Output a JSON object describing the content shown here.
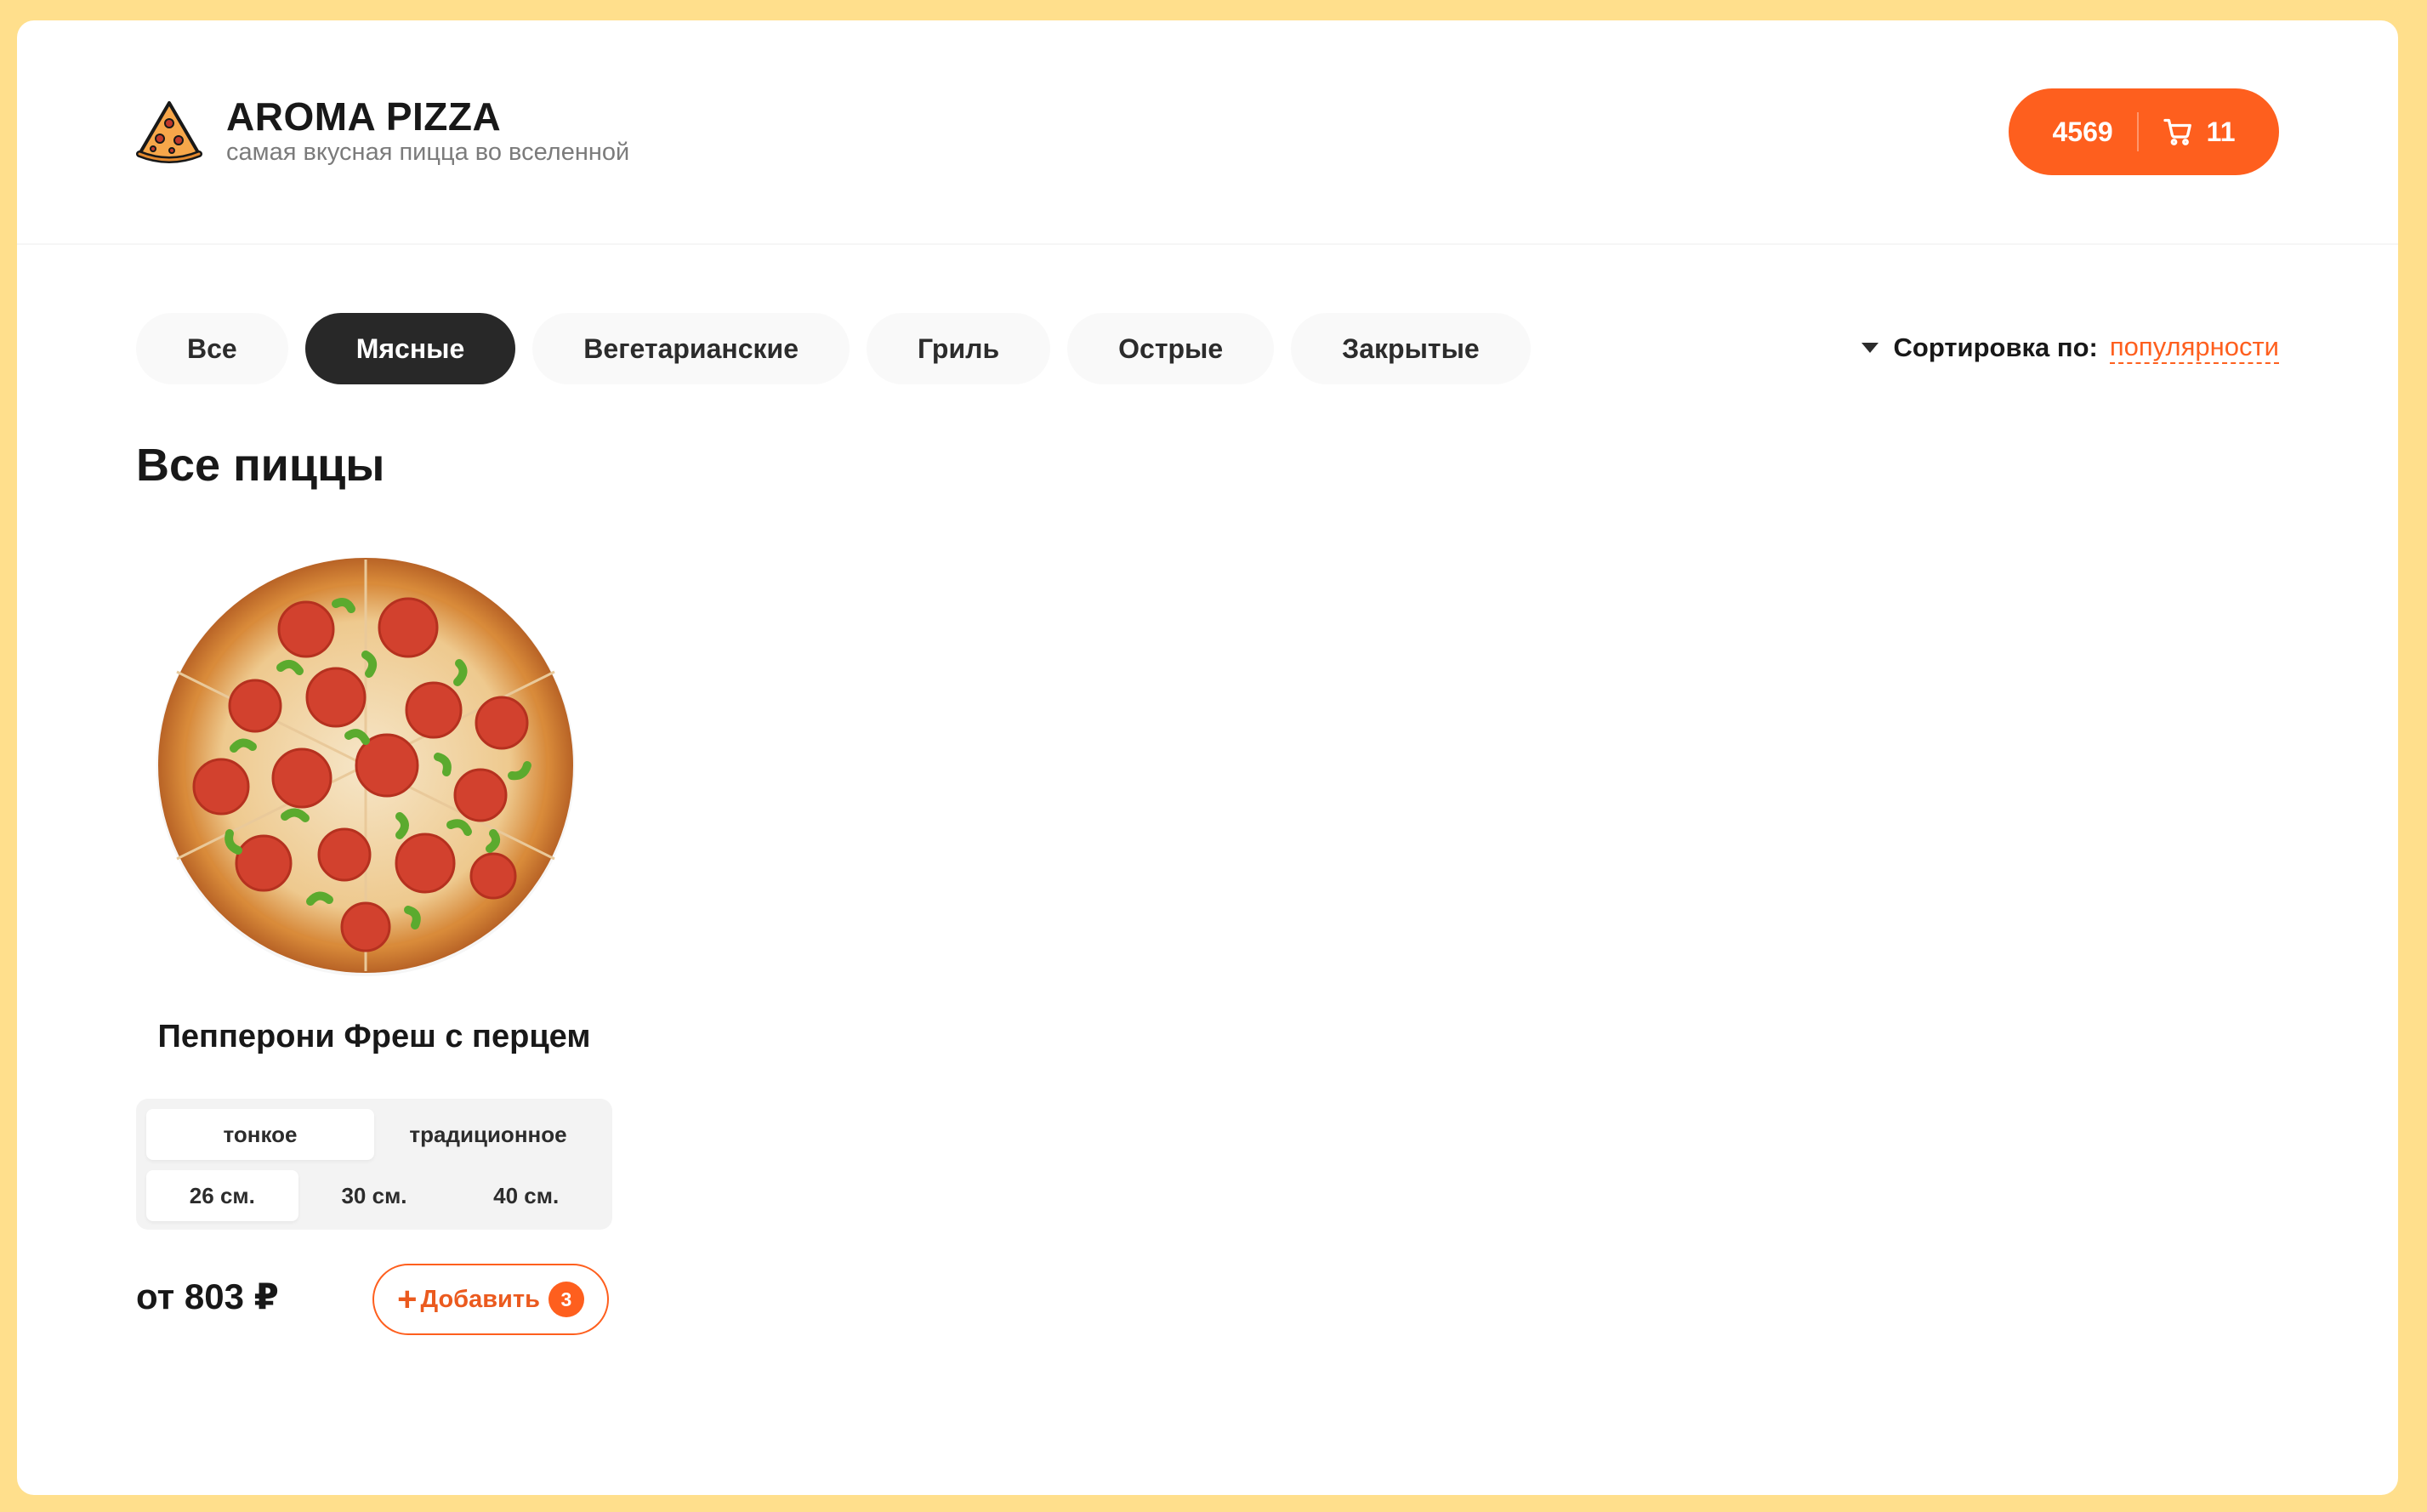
{
  "brand": {
    "title": "AROMA PIZZA",
    "subtitle": "самая вкусная пицца во вселенной"
  },
  "cart": {
    "price": "4569",
    "count": "11",
    "icon": "cart-icon"
  },
  "categories": [
    {
      "label": "Все",
      "active": false
    },
    {
      "label": "Мясные",
      "active": true
    },
    {
      "label": "Вегетарианские",
      "active": false
    },
    {
      "label": "Гриль",
      "active": false
    },
    {
      "label": "Острые",
      "active": false
    },
    {
      "label": "Закрытые",
      "active": false
    }
  ],
  "sort": {
    "label": "Сортировка по:",
    "value": "популярности"
  },
  "section_title": "Все пиццы",
  "pizzas": [
    {
      "name": "Пепперони Фреш с перцем",
      "dough_types": [
        {
          "label": "тонкое",
          "active": true
        },
        {
          "label": "традиционное",
          "active": false
        }
      ],
      "sizes": [
        {
          "label": "26 см.",
          "active": true
        },
        {
          "label": "30 см.",
          "active": false
        },
        {
          "label": "40 см.",
          "active": false
        }
      ],
      "price": "от 803 ₽",
      "add_label": "Добавить",
      "add_plus": "+",
      "added_count": "3"
    }
  ],
  "colors": {
    "accent": "#FE5F1E",
    "page_bg": "#FFDF8C",
    "active_category": "#282828"
  }
}
